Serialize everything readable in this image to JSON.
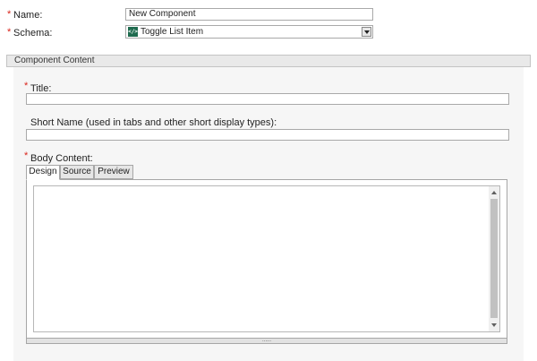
{
  "form": {
    "name_label": "Name:",
    "name_value": "New Component",
    "schema_label": "Schema:",
    "schema_value": "Toggle List Item",
    "required_marker": "*"
  },
  "section": {
    "title": "Component Content"
  },
  "fields": {
    "title_label": "Title:",
    "title_value": "",
    "short_name_label": "Short Name (used in tabs and other short display types):",
    "short_name_value": "",
    "body_label": "Body Content:"
  },
  "editor": {
    "tabs": [
      {
        "label": "Design",
        "active": true
      },
      {
        "label": "Source",
        "active": false
      },
      {
        "label": "Preview",
        "active": false
      }
    ],
    "content": "",
    "resize_grip": "......"
  },
  "icons": {
    "schema": "code-brackets-icon",
    "dropdown": "chevron-down-icon"
  },
  "colors": {
    "required": "#d9241b",
    "schema_icon_bg": "#1f6b4f",
    "section_header_bg": "#e9e9e9",
    "section_body_bg": "#f6f6f6"
  }
}
